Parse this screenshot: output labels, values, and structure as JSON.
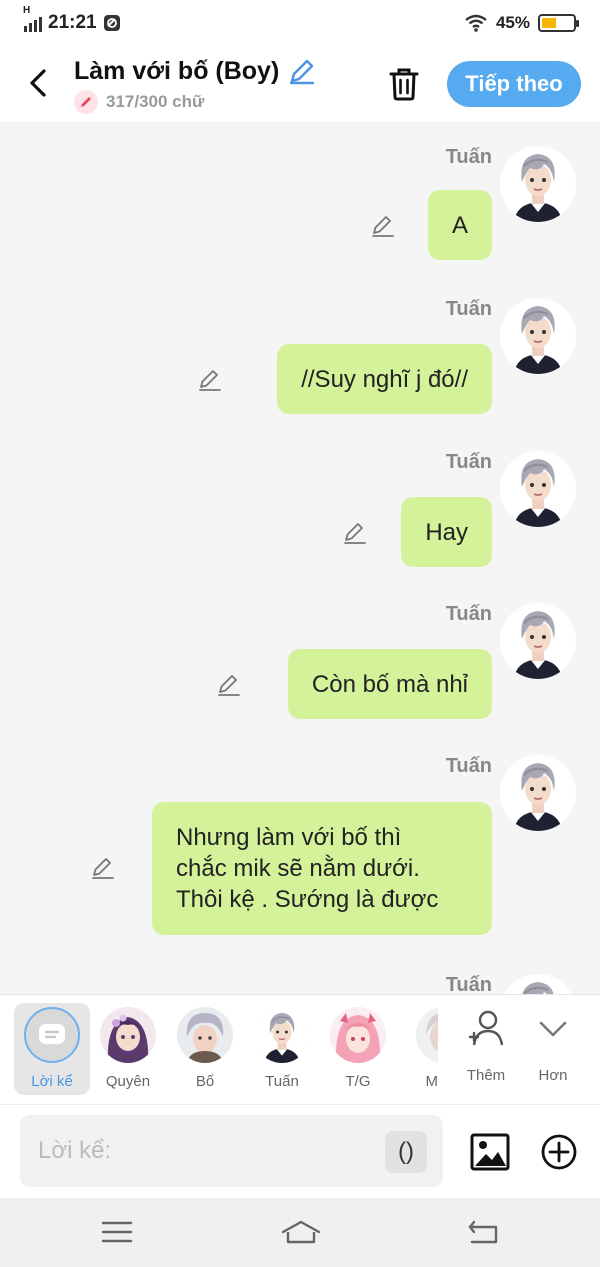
{
  "status_bar": {
    "time": "21:21",
    "network": "H",
    "battery": "45%",
    "battery_level": 0.45
  },
  "header": {
    "title": "Làm với bố (Boy)",
    "word_count": "317/300 chữ",
    "next_label": "Tiếp theo"
  },
  "messages": [
    {
      "sender": "Tuấn",
      "text": "A"
    },
    {
      "sender": "Tuấn",
      "text": "//Suy nghĩ j đó//"
    },
    {
      "sender": "Tuấn",
      "text": "Hay"
    },
    {
      "sender": "Tuấn",
      "text": "Còn bố mà nhỉ"
    },
    {
      "sender": "Tuấn",
      "lines": [
        "Nhưng làm với bố thì",
        "chắc mik sẽ nằm dưới.",
        "Thôi kệ . Sướng là được"
      ]
    },
    {
      "sender": "Tuấn"
    }
  ],
  "characters": [
    {
      "label": "Lời kể"
    },
    {
      "label": "Quyên"
    },
    {
      "label": "Bố"
    },
    {
      "label": "Tuấn"
    },
    {
      "label": "T/G"
    },
    {
      "label": "M"
    }
  ],
  "char_actions": {
    "add_label": "Thêm",
    "more_label": "Hơn"
  },
  "composer": {
    "placeholder": "Lời kể:",
    "paren_label": "()"
  },
  "colors": {
    "accent": "#56aaf0",
    "bubble": "#d3f29a"
  }
}
